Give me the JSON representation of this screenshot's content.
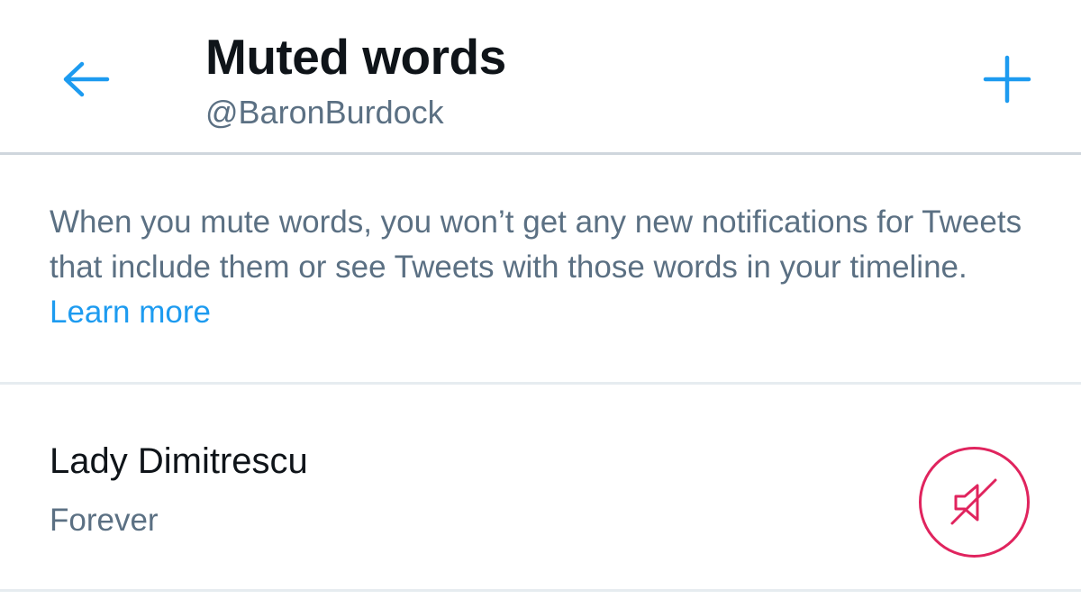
{
  "header": {
    "title": "Muted words",
    "subtitle": "@BaronBurdock",
    "back_icon": "arrow-left-icon",
    "add_icon": "plus-icon"
  },
  "info": {
    "text": "When you mute words, you won’t get any new notifications for Tweets that include them or see Tweets with those words in your timeline.",
    "link_label": "Learn more"
  },
  "muted_words": [
    {
      "word": "Lady Dimitrescu",
      "duration": "Forever",
      "icon": "speaker-muted-icon"
    }
  ],
  "colors": {
    "accent": "#1d9bf0",
    "primary_text": "#0f1419",
    "secondary_text": "#5b7083",
    "unmute": "#e0245e",
    "divider": "#e6ecf0"
  }
}
